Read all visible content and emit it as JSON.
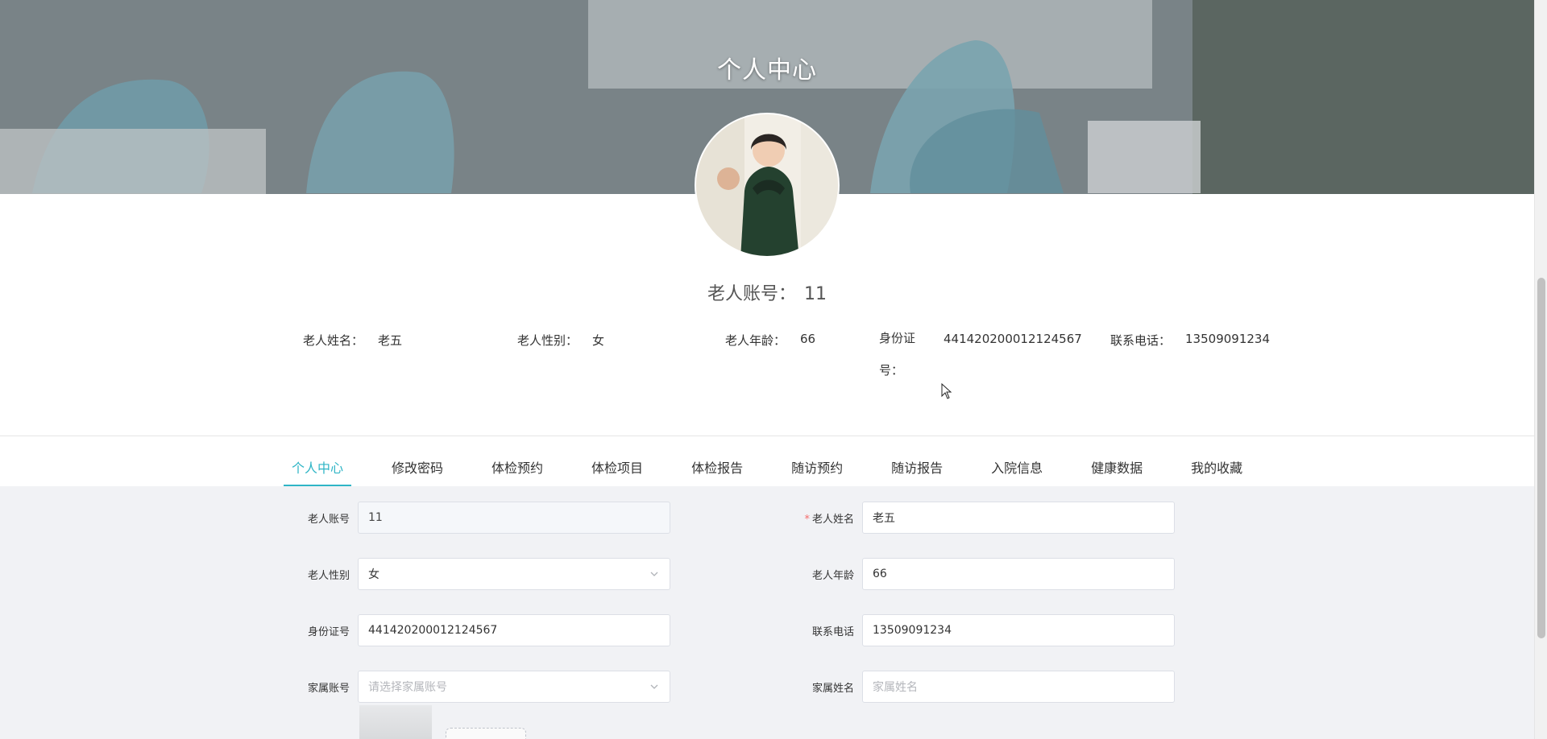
{
  "banner": {
    "title": "个人中心"
  },
  "profile": {
    "account_label": "老人账号：",
    "account_value": "11",
    "info": [
      {
        "label": "老人姓名：",
        "value": "老五"
      },
      {
        "label": "老人性别：",
        "value": "女"
      },
      {
        "label": "老人年龄：",
        "value": "66"
      },
      {
        "label": "身份证号：",
        "value": "441420200012124567"
      },
      {
        "label": "联系电话：",
        "value": "13509091234"
      }
    ]
  },
  "tabs": [
    {
      "label": "个人中心",
      "active": true
    },
    {
      "label": "修改密码"
    },
    {
      "label": "体检预约"
    },
    {
      "label": "体检项目"
    },
    {
      "label": "体检报告"
    },
    {
      "label": "随访预约"
    },
    {
      "label": "随访报告"
    },
    {
      "label": "入院信息"
    },
    {
      "label": "健康数据"
    },
    {
      "label": "我的收藏"
    }
  ],
  "form": {
    "account": {
      "label": "老人账号",
      "value": "11"
    },
    "name": {
      "label": "老人姓名",
      "value": "老五",
      "required_mark": "*"
    },
    "gender": {
      "label": "老人性别",
      "value": "女"
    },
    "age": {
      "label": "老人年龄",
      "value": "66"
    },
    "id_card": {
      "label": "身份证号",
      "value": "441420200012124567"
    },
    "phone": {
      "label": "联系电话",
      "value": "13509091234"
    },
    "family_account": {
      "label": "家属账号",
      "placeholder": "请选择家属账号"
    },
    "family_name": {
      "label": "家属姓名",
      "placeholder": "家属姓名"
    }
  },
  "icons": {
    "select_arrow": "chevron-down-icon"
  },
  "colors": {
    "accent": "#2fb5c6",
    "required": "#f56c6c",
    "form_bg": "#f1f2f5"
  }
}
